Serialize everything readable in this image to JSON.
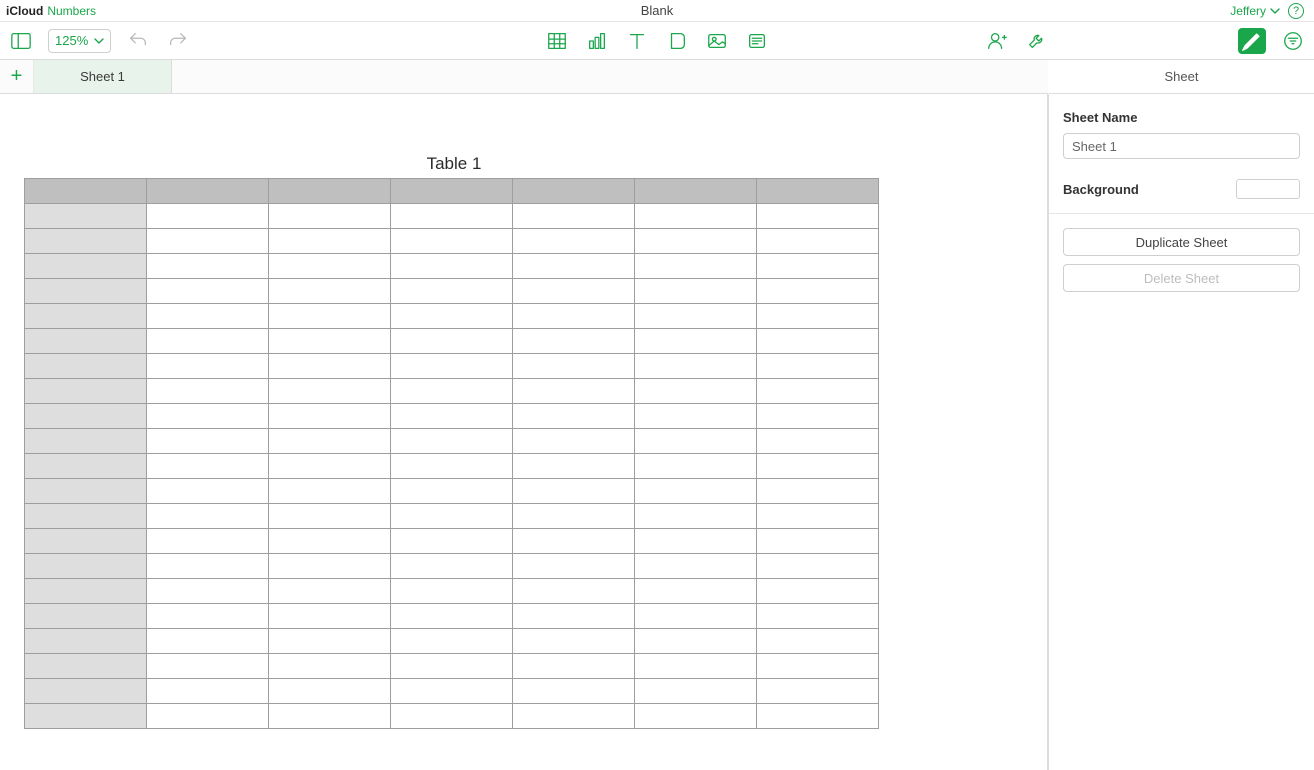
{
  "titlebar": {
    "brand_prefix": "iCloud",
    "brand_suffix": "Numbers",
    "document_title": "Blank",
    "user_name": "Jeffery",
    "help_char": "?"
  },
  "toolbar": {
    "zoom_label": "125%"
  },
  "tabs": {
    "active_sheet_label": "Sheet 1",
    "add_char": "+"
  },
  "panel": {
    "header": "Sheet",
    "name_label": "Sheet Name",
    "name_value": "Sheet 1",
    "background_label": "Background",
    "background_color": "#ffffff",
    "duplicate_label": "Duplicate Sheet",
    "delete_label": "Delete Sheet"
  },
  "table": {
    "title": "Table 1",
    "columns": 7,
    "rows": 22
  }
}
